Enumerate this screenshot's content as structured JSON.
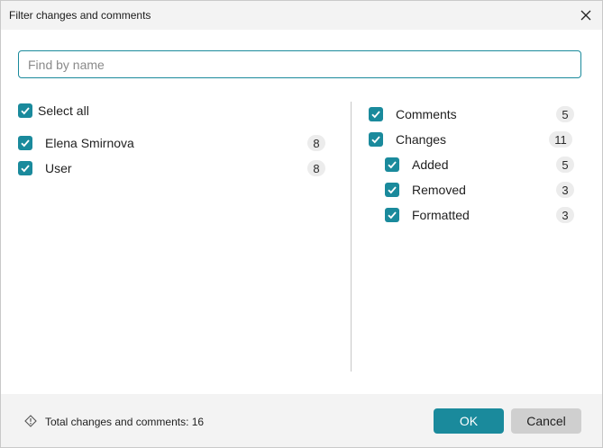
{
  "window": {
    "title": "Filter changes and comments",
    "close_icon": "close-icon"
  },
  "search": {
    "placeholder": "Find by name",
    "value": ""
  },
  "authors": {
    "select_all": {
      "label": "Select all",
      "checked": true
    },
    "items": [
      {
        "label": "Elena Smirnova",
        "count": "8",
        "checked": true
      },
      {
        "label": "User",
        "count": "8",
        "checked": true
      }
    ]
  },
  "types": {
    "items": [
      {
        "label": "Comments",
        "count": "5",
        "checked": true
      },
      {
        "label": "Changes",
        "count": "11",
        "checked": true
      },
      {
        "label": "Added",
        "count": "5",
        "checked": true
      },
      {
        "label": "Removed",
        "count": "3",
        "checked": true
      },
      {
        "label": "Formatted",
        "count": "3",
        "checked": true
      }
    ]
  },
  "footer": {
    "info_icon": "info-diamond-icon",
    "summary": "Total changes and comments: 16",
    "ok_label": "OK",
    "cancel_label": "Cancel"
  },
  "colors": {
    "accent": "#1a8a9c",
    "badge_bg": "#ececec",
    "panel_bg": "#f3f3f3",
    "cancel_bg": "#cfcfcf"
  }
}
